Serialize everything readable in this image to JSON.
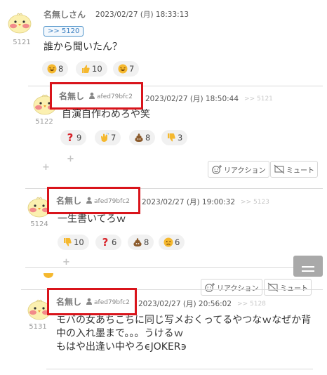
{
  "posts": [
    {
      "number": "5121",
      "name": "名無しさん",
      "date": "2023/02/27 (月) 18:33:13",
      "reply_ref": ">> 5120",
      "body": [
        "誰から聞いたん？"
      ],
      "reactions": [
        {
          "emoji": "grin",
          "count": "8"
        },
        {
          "emoji": "thumbs-up",
          "count": "10"
        },
        {
          "emoji": "grin",
          "count": "7"
        }
      ]
    },
    {
      "number": "5122",
      "name": "名無し",
      "id": "afed79bfc2",
      "date": "2023/02/27 (月) 18:50:44",
      "ref": ">> 5121",
      "body": [
        "自演自作わめろや笑"
      ],
      "reactions": [
        {
          "emoji": "question",
          "count": "9"
        },
        {
          "emoji": "clap",
          "count": "7"
        },
        {
          "emoji": "poop",
          "count": "8"
        },
        {
          "emoji": "thumbs-down",
          "count": "3"
        }
      ]
    },
    {
      "number": "5124",
      "name": "名無し",
      "id": "afed79bfc2",
      "date": "2023/02/27 (月) 19:00:32",
      "ref": ">> 5123",
      "body": [
        "一生書いてろｗ"
      ],
      "reactions": [
        {
          "emoji": "thumbs-down",
          "count": "10"
        },
        {
          "emoji": "question",
          "count": "6"
        },
        {
          "emoji": "poop",
          "count": "8"
        },
        {
          "emoji": "sad",
          "count": "6"
        }
      ]
    },
    {
      "number": "5131",
      "name": "名無し",
      "id": "afed79bfc2",
      "date": "2023/02/27 (月) 20:56:02",
      "ref": ">> 5128",
      "body": [
        "モバの女あちこちに同じ写メおくってるやつなｗなぜか背",
        "中の入れ墨まで。。。うけるｗ",
        "もはや出逢い中やろϵJOKER϶"
      ]
    }
  ],
  "actions": {
    "reaction_label": "リアクション",
    "mute_label": "ミュート"
  },
  "icons": {
    "avatar": "chick-avatar-icon",
    "user": "user-icon",
    "reaction": "smiley-plus-icon",
    "mute": "mute-icon",
    "plus": "plus-icon"
  },
  "colors": {
    "highlight": "#d9141b",
    "link": "#3a7fc0"
  }
}
